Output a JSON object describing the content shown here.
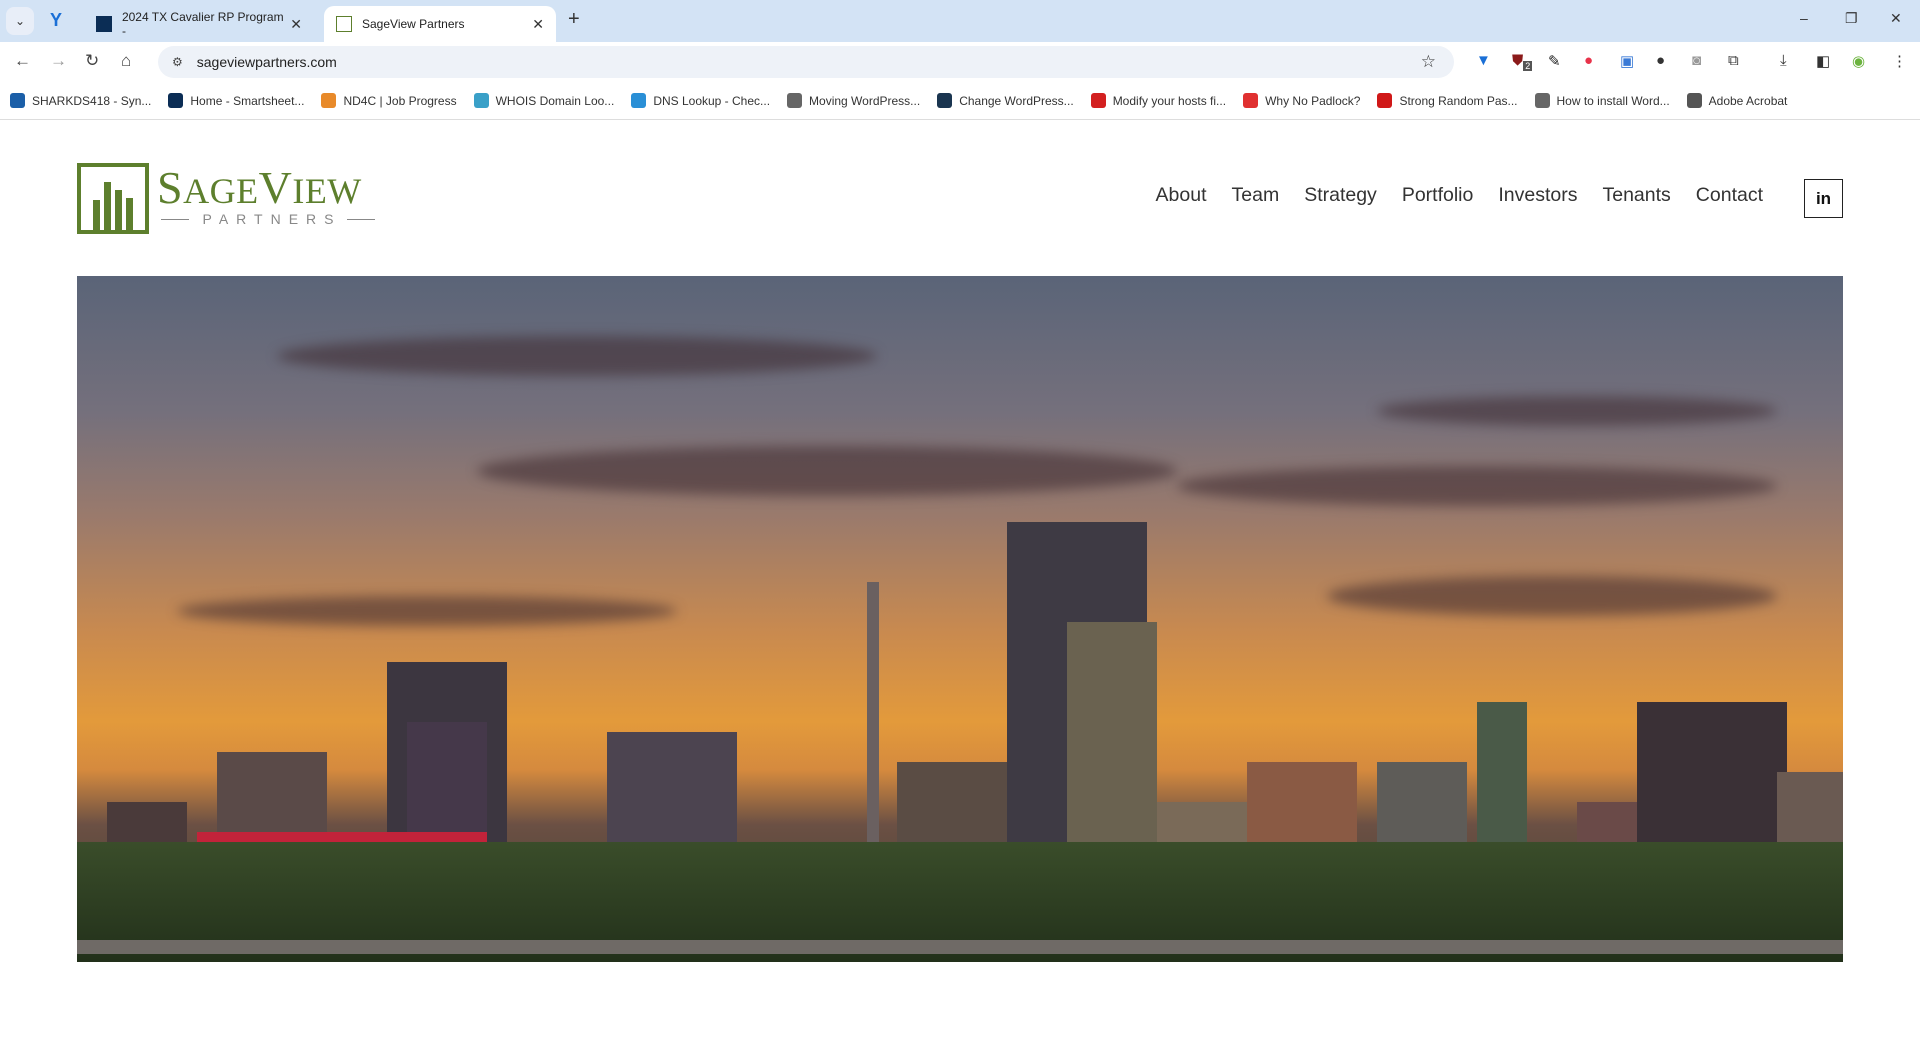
{
  "browser": {
    "tabs": [
      {
        "title": "2024 TX Cavalier RP Program -",
        "active": false
      },
      {
        "title": "SageView Partners",
        "active": true
      }
    ],
    "url": "sageviewpartners.com",
    "extension_badge": "2",
    "bookmarks": [
      {
        "label": "SHARKDS418 - Syn...",
        "color": "#1b5fa8"
      },
      {
        "label": "Home - Smartsheet...",
        "color": "#0b2d55"
      },
      {
        "label": "ND4C | Job Progress",
        "color": "#e88a2a"
      },
      {
        "label": "WHOIS Domain Loo...",
        "color": "#3aa0c8"
      },
      {
        "label": "DNS Lookup - Chec...",
        "color": "#2a8fd6"
      },
      {
        "label": "Moving WordPress...",
        "color": "#666666"
      },
      {
        "label": "Change WordPress...",
        "color": "#1a3550"
      },
      {
        "label": "Modify your hosts fi...",
        "color": "#d32020"
      },
      {
        "label": "Why No Padlock?",
        "color": "#e03030"
      },
      {
        "label": "Strong Random Pas...",
        "color": "#d01818"
      },
      {
        "label": "How to install Word...",
        "color": "#666666"
      },
      {
        "label": "Adobe Acrobat",
        "color": "#555555"
      }
    ]
  },
  "site": {
    "logo": {
      "title_first": "S",
      "title_rest": "AGE",
      "title_v": "V",
      "title_end": "IEW",
      "subtitle": "PARTNERS",
      "brand_color": "#5d7f2d"
    },
    "nav": [
      "About",
      "Team",
      "Strategy",
      "Portfolio",
      "Investors",
      "Tenants",
      "Contact"
    ],
    "linkedin_label": "in"
  }
}
